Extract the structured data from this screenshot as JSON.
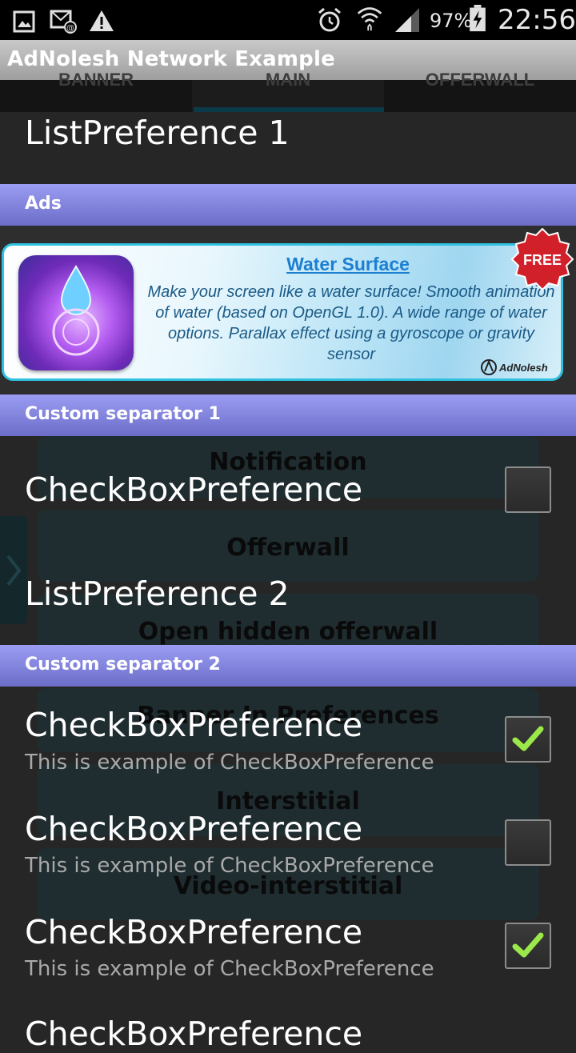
{
  "status_bar": {
    "battery_percent": "97%",
    "time": "22:56",
    "left_icons": [
      "gallery-icon",
      "email-sync-icon",
      "warning-icon"
    ],
    "right_icons": [
      "alarm-icon",
      "wifi-icon",
      "signal-icon",
      "battery-charging-icon"
    ]
  },
  "app": {
    "title": "AdNolesh Network Example"
  },
  "tabs": [
    {
      "label": "BANNER"
    },
    {
      "label": "MAIN"
    },
    {
      "label": "OFFERWALL"
    }
  ],
  "background_buttons": [
    {
      "label": "Notification"
    },
    {
      "label": "Offerwall"
    },
    {
      "label": "Open hidden offerwall"
    },
    {
      "label": "Banner In Preferences"
    },
    {
      "label": "Interstitial"
    },
    {
      "label": "Video-interstitial"
    }
  ],
  "preferences": {
    "list1": {
      "title": "ListPreference 1"
    },
    "ads_header": "Ads",
    "ad": {
      "title": "Water Surface",
      "description": "Make your screen like a water surface! Smooth animation of water (based on OpenGL 1.0). A wide range of water options. Parallax effect using a gyroscope or gravity sensor",
      "badge": "FREE",
      "brand": "AdNolesh"
    },
    "separator1": "Custom separator 1",
    "checkbox1": {
      "title": "CheckBoxPreference",
      "checked": false
    },
    "list2": {
      "title": "ListPreference 2"
    },
    "separator2": "Custom separator 2",
    "checkbox2": {
      "title": "CheckBoxPreference",
      "summary": "This is example of CheckBoxPreference",
      "checked": true
    },
    "checkbox3": {
      "title": "CheckBoxPreference",
      "summary": "This is example of CheckBoxPreference",
      "checked": false
    },
    "checkbox4": {
      "title": "CheckBoxPreference",
      "summary": "This is example of CheckBoxPreference",
      "checked": true
    },
    "checkbox5": {
      "title": "CheckBoxPreference"
    }
  },
  "colors": {
    "separator": "#8081dc",
    "check": "#9be84a",
    "ad_title": "#1d7fd0",
    "ad_border": "#2fc1df"
  }
}
